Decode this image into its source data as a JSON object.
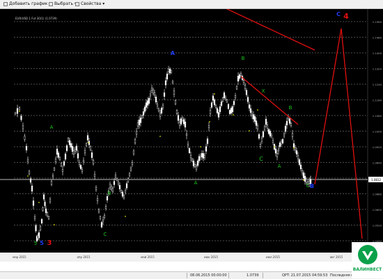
{
  "toolbar": {
    "add_chart_label": "Добавить график",
    "select_label": "Выбрать",
    "properties_label": "Свойства"
  },
  "chart": {
    "title": "EUR/USD 1 Fut 30(1) (1.0739)",
    "current_price_label": "1.0812",
    "grid_on": true,
    "colors": {
      "background": "#000000",
      "candles": "#ffffff",
      "grid": "#9a9a9a",
      "trendlines": "#e01010",
      "wave_labels_green": "#1ec81e",
      "wave_labels_small": "#d8d800",
      "wave_labels_blue": "#1e3cff",
      "wave_labels_red": "#e01010"
    }
  },
  "chart_data": {
    "type": "candlestick",
    "x_tick_labels": [
      "мар 2015",
      "апр 2015",
      "май 2015",
      "июн 2015",
      "июл 2015",
      "авг 2015"
    ],
    "y_tick_labels": [
      "1.1560",
      "1.1480",
      "1.1400",
      "1.1320",
      "1.1240",
      "1.1160",
      "1.1080",
      "1.1000",
      "1.0920",
      "1.0840",
      "1.0760",
      "1.0680",
      "1.0600",
      "1.0520",
      "1.0440"
    ],
    "wave_labels": [
      {
        "text": "5",
        "color": "green"
      },
      {
        "text": "5",
        "color": "blue"
      },
      {
        "text": "3",
        "color": "red"
      },
      {
        "text": "A",
        "color": "green"
      },
      {
        "text": "B",
        "color": "green"
      },
      {
        "text": "C",
        "color": "green"
      },
      {
        "text": "A",
        "color": "blue"
      },
      {
        "text": "B",
        "color": "green"
      },
      {
        "text": "A",
        "color": "green"
      },
      {
        "text": "X",
        "color": "green"
      },
      {
        "text": "C",
        "color": "green"
      },
      {
        "text": "A",
        "color": "green"
      },
      {
        "text": "B",
        "color": "green"
      },
      {
        "text": "C",
        "color": "green"
      },
      {
        "text": "B",
        "color": "blue"
      },
      {
        "text": "C",
        "color": "blue"
      },
      {
        "text": "4",
        "color": "red"
      },
      {
        "text": "C",
        "color": "yellow"
      },
      {
        "text": "5",
        "color": "red"
      }
    ]
  },
  "status": {
    "date_range": "08.06.2015 00:00:00",
    "price": "1.0739",
    "server_time": "QPT:  21.07.2015 04:59:53",
    "last_event": "Последняя врем"
  },
  "logo": {
    "text": "ВАЛИНВЕСТ"
  }
}
